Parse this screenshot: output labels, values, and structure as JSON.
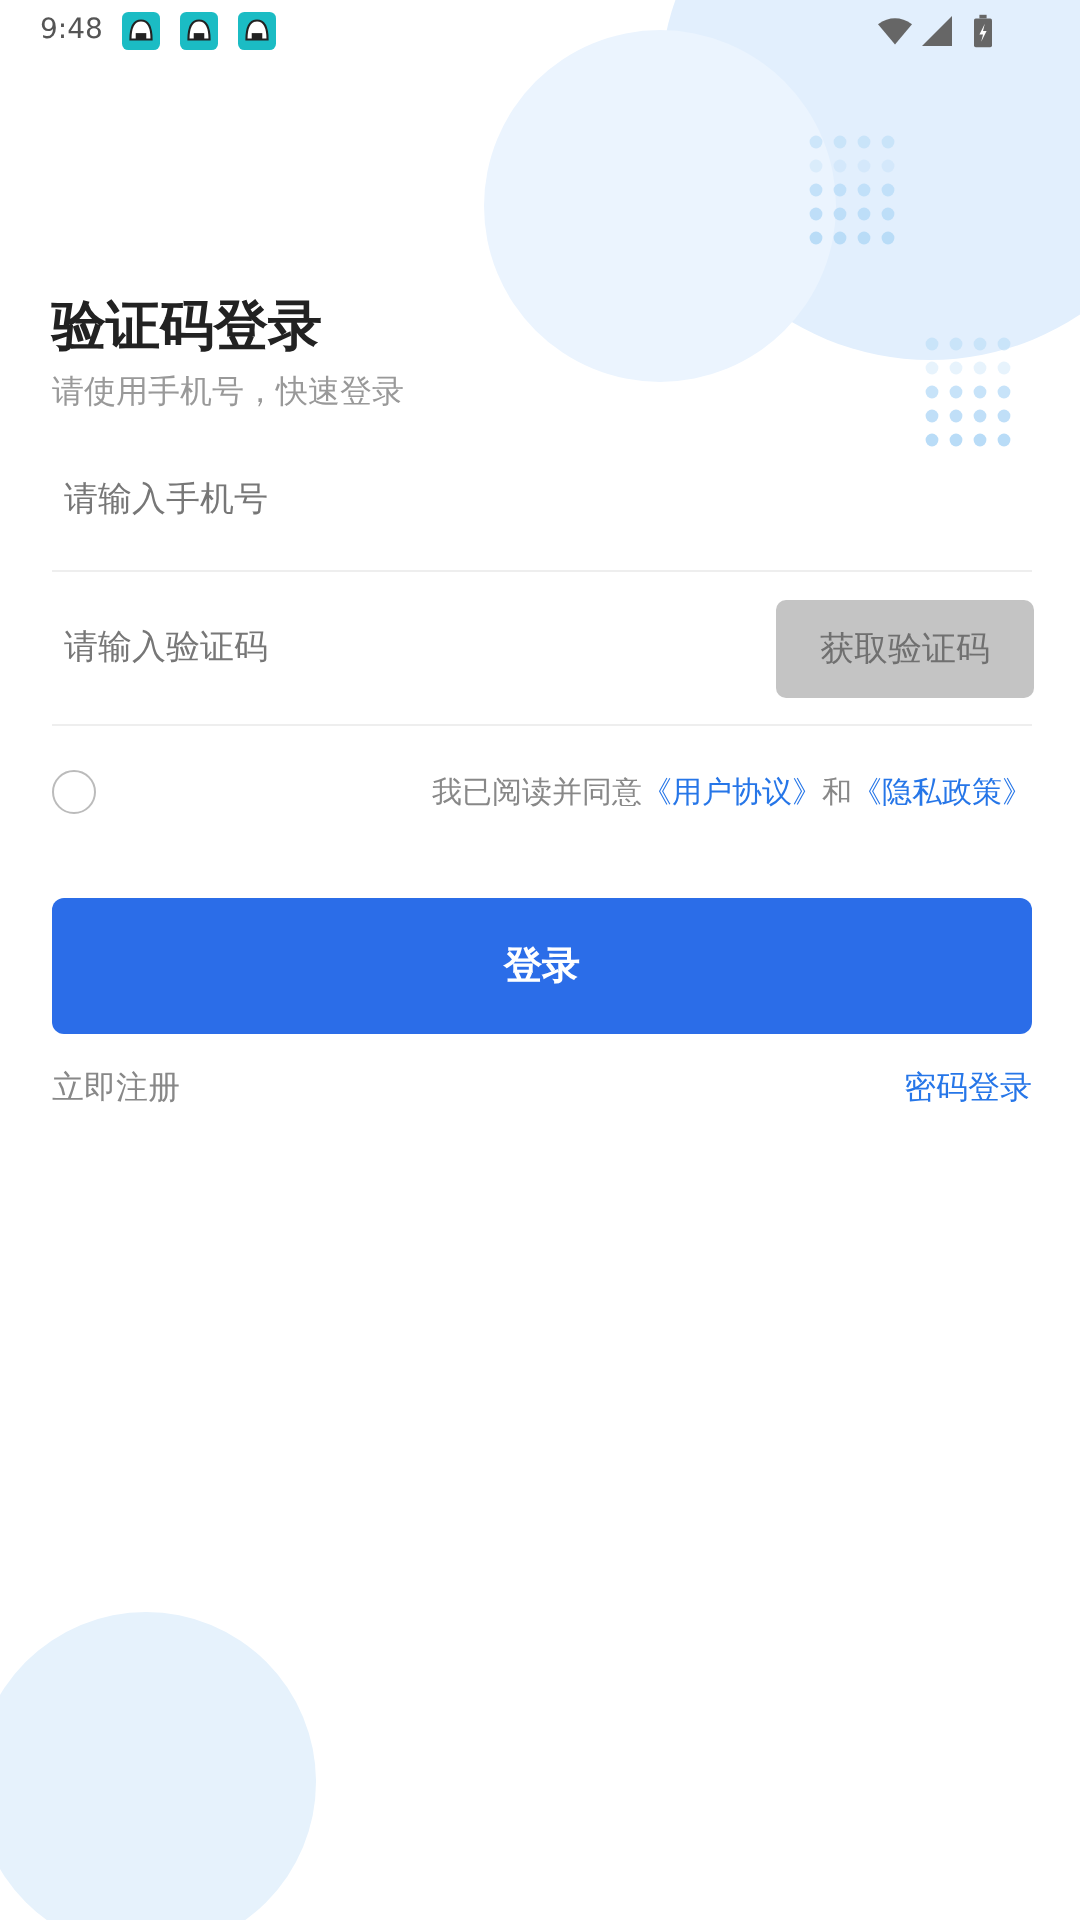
{
  "status_bar": {
    "time": "9:48"
  },
  "title": "验证码登录",
  "subtitle": "请使用手机号，快速登录",
  "phone_field": {
    "placeholder": "请输入手机号"
  },
  "code_field": {
    "placeholder": "请输入验证码"
  },
  "get_code_button": {
    "label": "获取验证码",
    "disabled": true
  },
  "agreement": {
    "checked": false,
    "prefix": "我已阅读并同意",
    "user_agreement": "《用户协议》",
    "conjunction": "和",
    "privacy_policy": "《隐私政策》"
  },
  "login_button": {
    "label": "登录"
  },
  "register_link": "立即注册",
  "password_login_link": "密码登录"
}
